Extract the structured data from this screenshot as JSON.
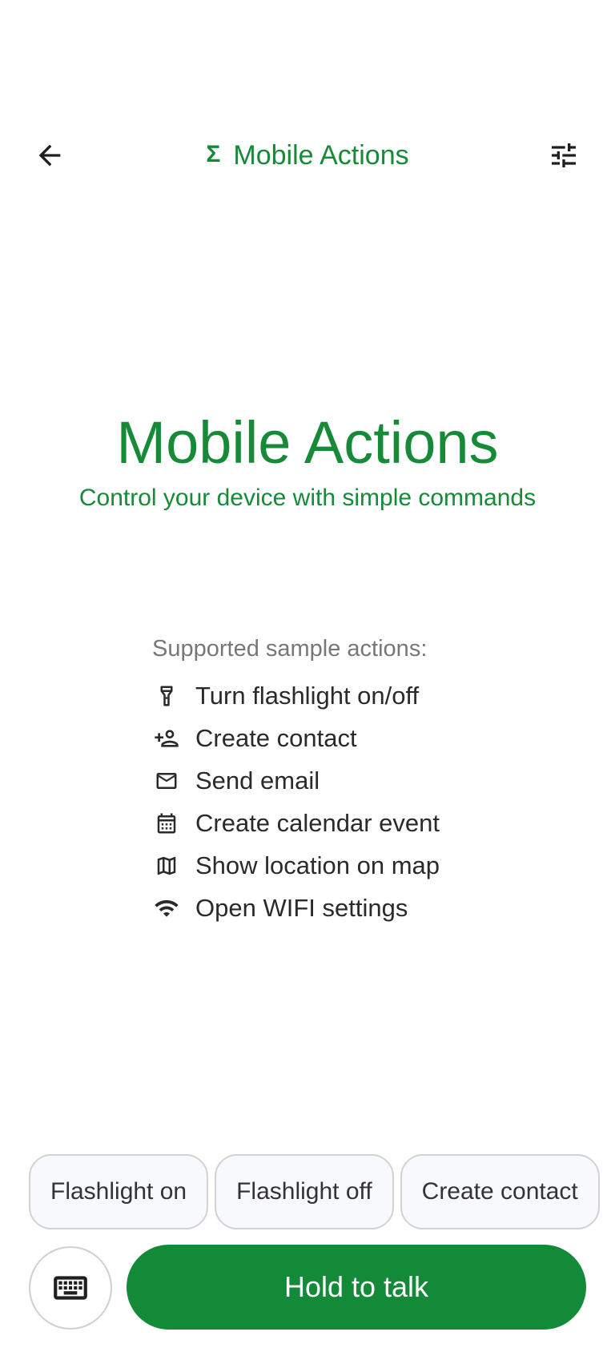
{
  "header": {
    "title": "Mobile Actions",
    "title_symbol": "Σ",
    "back_icon": "arrow-back-icon",
    "settings_icon": "tune-icon"
  },
  "hero": {
    "title": "Mobile Actions",
    "subtitle": "Control your device with simple commands"
  },
  "supported": {
    "heading": "Supported sample actions:",
    "items": [
      {
        "icon": "flashlight-icon",
        "label": "Turn flashlight on/off"
      },
      {
        "icon": "person-add-icon",
        "label": "Create contact"
      },
      {
        "icon": "mail-icon",
        "label": "Send email"
      },
      {
        "icon": "calendar-icon",
        "label": "Create calendar event"
      },
      {
        "icon": "map-icon",
        "label": "Show location on map"
      },
      {
        "icon": "wifi-icon",
        "label": "Open WIFI settings"
      }
    ]
  },
  "chips": [
    "Flashlight on",
    "Flashlight off",
    "Create contact"
  ],
  "controls": {
    "keyboard_icon": "keyboard-icon",
    "talk_label": "Hold to talk"
  },
  "colors": {
    "brand_green": "#168A37",
    "button_green": "#128A37",
    "chip_background": "#F8F9FD",
    "muted_text": "#777777"
  }
}
